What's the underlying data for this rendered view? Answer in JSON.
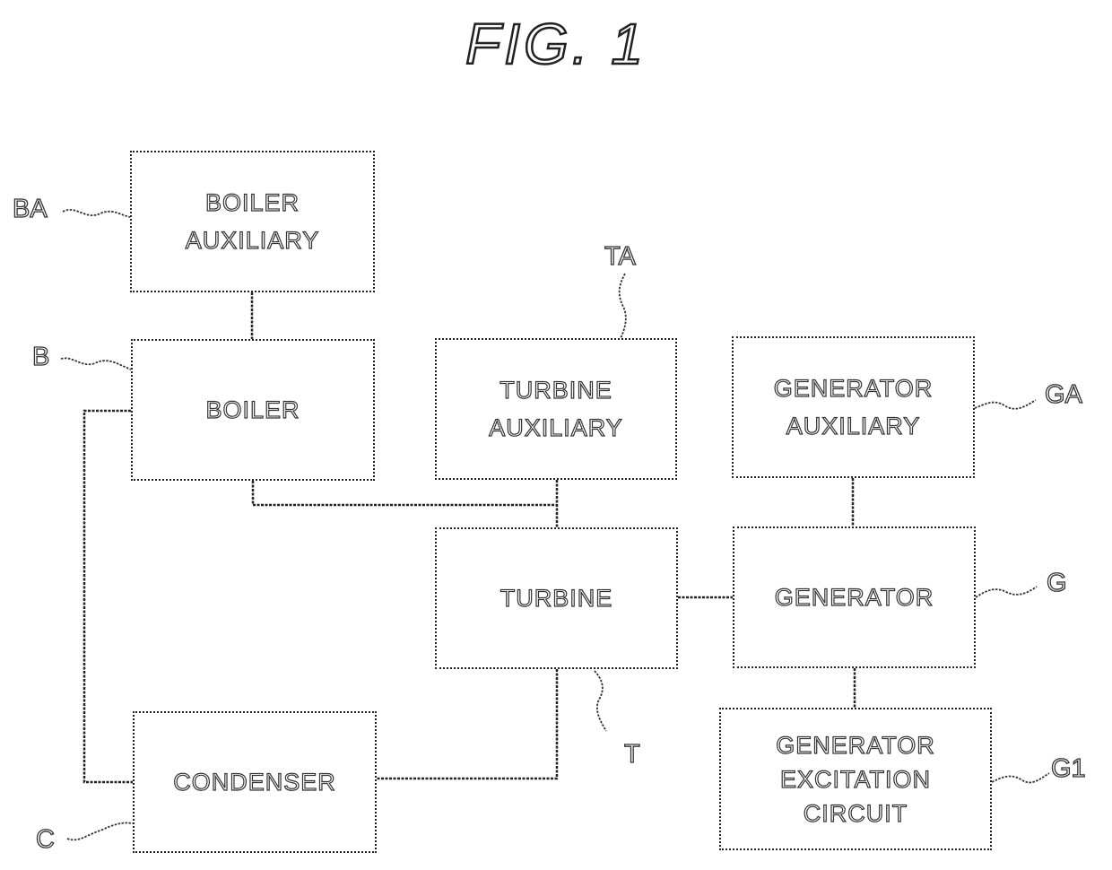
{
  "figure": {
    "title": "FIG. 1"
  },
  "blocks": {
    "boiler_auxiliary": {
      "ref": "BA",
      "lines": [
        "BOILER",
        "AUXILIARY"
      ]
    },
    "boiler": {
      "ref": "B",
      "lines": [
        "BOILER"
      ]
    },
    "turbine_auxiliary": {
      "ref": "TA",
      "lines": [
        "TURBINE",
        "AUXILIARY"
      ]
    },
    "generator_auxiliary": {
      "ref": "GA",
      "lines": [
        "GENERATOR",
        "AUXILIARY"
      ]
    },
    "turbine": {
      "ref": "T",
      "lines": [
        "TURBINE"
      ]
    },
    "generator": {
      "ref": "G",
      "lines": [
        "GENERATOR"
      ]
    },
    "generator_excitation_circuit": {
      "ref": "G1",
      "lines": [
        "GENERATOR",
        "EXCITATION",
        "CIRCUIT"
      ]
    },
    "condenser": {
      "ref": "C",
      "lines": [
        "CONDENSER"
      ]
    }
  },
  "connections": [
    {
      "from": "boiler_auxiliary",
      "to": "boiler"
    },
    {
      "from": "boiler",
      "to": "turbine"
    },
    {
      "from": "turbine_auxiliary",
      "to": "turbine"
    },
    {
      "from": "boiler",
      "to": "condenser"
    },
    {
      "from": "turbine",
      "to": "condenser"
    },
    {
      "from": "turbine",
      "to": "generator"
    },
    {
      "from": "generator_auxiliary",
      "to": "generator"
    },
    {
      "from": "generator",
      "to": "generator_excitation_circuit"
    }
  ]
}
